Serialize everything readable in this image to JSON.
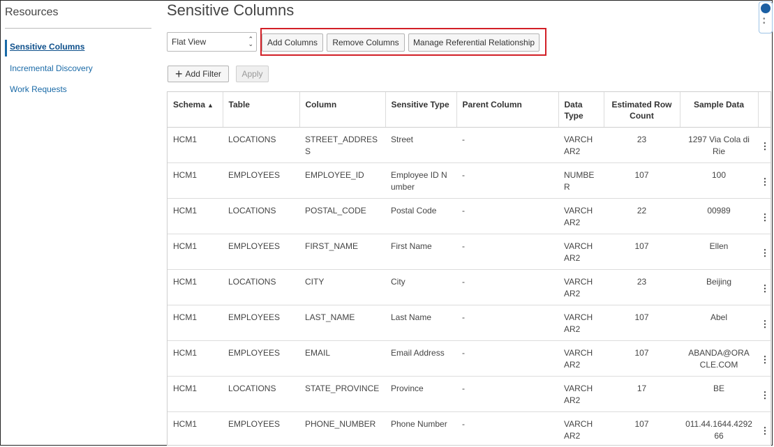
{
  "sidebar": {
    "title": "Resources",
    "items": [
      {
        "label": "Sensitive Columns",
        "active": true
      },
      {
        "label": "Incremental Discovery",
        "active": false
      },
      {
        "label": "Work Requests",
        "active": false
      }
    ]
  },
  "page": {
    "title": "Sensitive Columns"
  },
  "view_select": {
    "value": "Flat View"
  },
  "toolbar": {
    "add_columns": "Add Columns",
    "remove_columns": "Remove Columns",
    "manage_referential": "Manage Referential Relationship",
    "add_filter": "Add Filter",
    "apply": "Apply"
  },
  "table": {
    "headers": [
      "Schema",
      "Table",
      "Column",
      "Sensitive Type",
      "Parent Column",
      "Data Type",
      "Estimated Row Count",
      "Sample Data"
    ],
    "sort": {
      "column": "Schema",
      "direction": "ascending"
    },
    "rows": [
      [
        "HCM1",
        "LOCATIONS",
        "STREET_ADDRESS",
        "Street",
        "-",
        "VARCHAR2",
        "23",
        "1297 Via Cola di Rie"
      ],
      [
        "HCM1",
        "EMPLOYEES",
        "EMPLOYEE_ID",
        "Employee ID Number",
        "-",
        "NUMBER",
        "107",
        "100"
      ],
      [
        "HCM1",
        "LOCATIONS",
        "POSTAL_CODE",
        "Postal Code",
        "-",
        "VARCHAR2",
        "22",
        "00989"
      ],
      [
        "HCM1",
        "EMPLOYEES",
        "FIRST_NAME",
        "First Name",
        "-",
        "VARCHAR2",
        "107",
        "Ellen"
      ],
      [
        "HCM1",
        "LOCATIONS",
        "CITY",
        "City",
        "-",
        "VARCHAR2",
        "23",
        "Beijing"
      ],
      [
        "HCM1",
        "EMPLOYEES",
        "LAST_NAME",
        "Last Name",
        "-",
        "VARCHAR2",
        "107",
        "Abel"
      ],
      [
        "HCM1",
        "EMPLOYEES",
        "EMAIL",
        "Email Address",
        "-",
        "VARCHAR2",
        "107",
        "ABANDA@ORACLE.COM"
      ],
      [
        "HCM1",
        "LOCATIONS",
        "STATE_PROVINCE",
        "Province",
        "-",
        "VARCHAR2",
        "17",
        "BE"
      ],
      [
        "HCM1",
        "EMPLOYEES",
        "PHONE_NUMBER",
        "Phone Number",
        "-",
        "VARCHAR2",
        "107",
        "011.44.1644.429266"
      ]
    ]
  },
  "icons": {
    "sort": "sort-ascending-icon",
    "row_actions": "kebab-menu-icon",
    "select": "chevron-up-down-icon",
    "add": "plus-icon"
  },
  "colors": {
    "link": "#1a6aa7",
    "highlight_border": "#d21f26"
  }
}
